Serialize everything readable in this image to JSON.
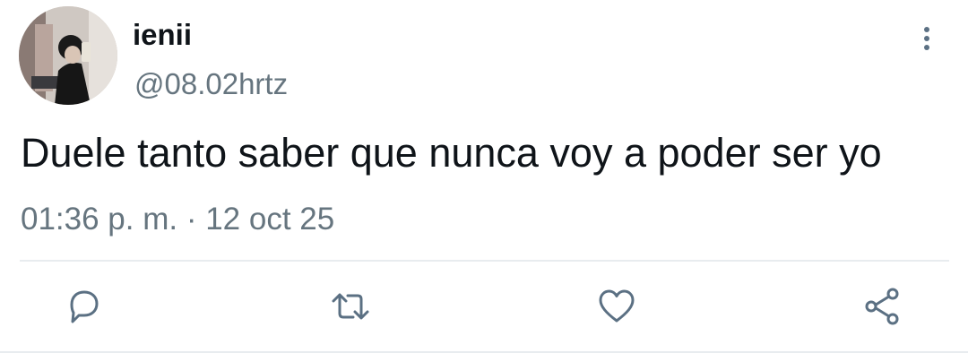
{
  "user": {
    "display_name": "ienii",
    "handle": "@08.02hrtz"
  },
  "tweet": {
    "text": "Duele tanto saber que nunca voy a poder ser yo",
    "timestamp": "01:36 p. m. · 12 oct 25"
  },
  "actions": [
    {
      "icon": "reply-icon"
    },
    {
      "icon": "retweet-icon"
    },
    {
      "icon": "like-icon"
    },
    {
      "icon": "share-icon"
    }
  ],
  "colors": {
    "text_primary": "#0f1419",
    "text_secondary": "#66757f",
    "icon": "#5b7083",
    "divider": "#e8ecef"
  }
}
